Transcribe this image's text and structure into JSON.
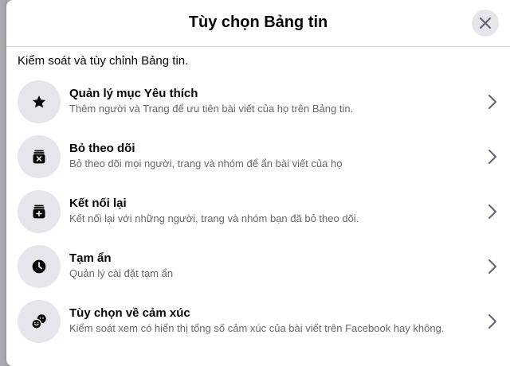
{
  "dialog": {
    "title": "Tùy chọn Bảng tin",
    "subtitle": "Kiểm soát và tùy chỉnh Bảng tin."
  },
  "items": [
    {
      "title": "Quản lý mục Yêu thích",
      "description": "Thêm người và Trang để ưu tiên bài viết của họ trên Bảng tin.",
      "icon": "star-icon"
    },
    {
      "title": "Bỏ theo dõi",
      "description": "Bỏ theo dõi mọi người, trang và nhóm để ẩn bài viết của họ",
      "icon": "unfollow-box-icon"
    },
    {
      "title": "Kết nối lại",
      "description": "Kết nối lại với những người, trang và nhóm bạn đã bỏ theo dõi.",
      "icon": "reconnect-box-icon"
    },
    {
      "title": "Tạm ẩn",
      "description": "Quản lý cài đặt tạm ẩn",
      "icon": "clock-icon"
    },
    {
      "title": "Tùy chọn về cảm xúc",
      "description": "Kiểm soát xem có hiển thị tổng số cảm xúc của bài viết trên Facebook hay không.",
      "icon": "reactions-icon"
    }
  ],
  "colors": {
    "icon_circle": "#e4e6eb",
    "primary_text": "#050505",
    "secondary_text": "#65676b",
    "divider": "#dadde1"
  }
}
